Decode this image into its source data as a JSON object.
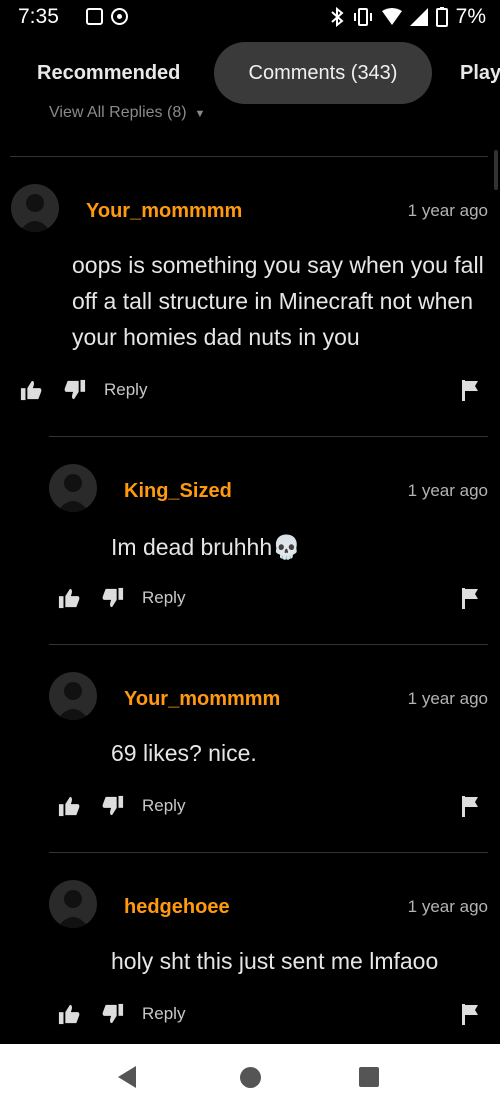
{
  "status_bar": {
    "time": "7:35",
    "battery": "7%",
    "icons": [
      "notification-icon",
      "sync-icon",
      "bluetooth-icon",
      "vibrate-icon",
      "wifi-icon",
      "signal-icon",
      "battery-icon"
    ]
  },
  "tabs": [
    {
      "label": "Recommended"
    },
    {
      "label": "Comments (343)"
    },
    {
      "label": "Play"
    }
  ],
  "view_replies": "View All Replies (8)",
  "comments": [
    {
      "username": "Your_mommmm",
      "time": "1 year ago",
      "text": "oops is something you say when you fall off a tall structure in Minecraft not when your homies dad nuts in you",
      "reply_label": "Reply"
    },
    {
      "username": "King_Sized",
      "time": "1 year ago",
      "text": "Im dead bruhhh💀",
      "reply_label": "Reply"
    },
    {
      "username": "Your_mommmm",
      "time": "1 year ago",
      "text": "69 likes? nice.",
      "reply_label": "Reply"
    },
    {
      "username": "hedgehoee",
      "time": "1 year ago",
      "text": "holy sht this just sent me lmfaoo",
      "reply_label": "Reply"
    }
  ],
  "colors": {
    "accent": "#ff9a0e",
    "background": "#000000",
    "tab_active_bg": "#3a3a3a"
  }
}
